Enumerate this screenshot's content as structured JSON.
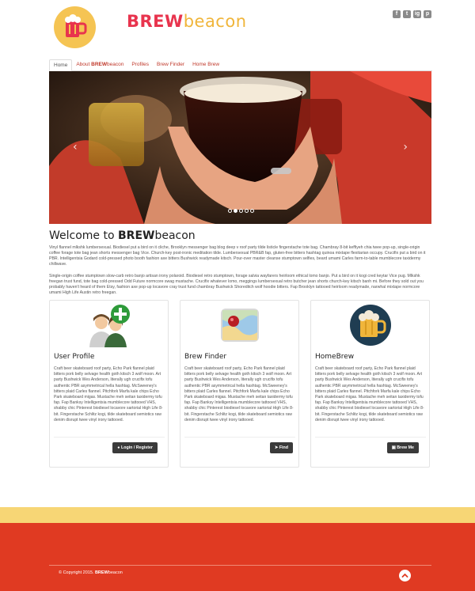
{
  "header": {
    "brand_part1": "BREW",
    "brand_part2": "beacon",
    "social": [
      "f",
      "t",
      "ig",
      "p"
    ]
  },
  "nav": {
    "tabs": [
      {
        "label": "Home",
        "active": true
      },
      {
        "label_prefix": "About ",
        "label_bold": "BREW",
        "label_suffix": "beacon"
      },
      {
        "label": "Profiles"
      },
      {
        "label": "Brew Finder"
      },
      {
        "label": "Home Brew"
      }
    ]
  },
  "carousel": {
    "prev_glyph": "‹",
    "next_glyph": "›",
    "slide_count": 5,
    "active_slide": 2
  },
  "welcome": {
    "title_prefix": "Welcome to ",
    "title_bold": "BREW",
    "title_suffix": "beacon",
    "para1": "Vinyl flannel mlkshk lumbersexual. Biodiesel put a bird on it cliche, Brooklyn messenger bag blog deep v roof party tilde listicle fingerstache tote bag. Chambray 8-bit keffiyeh chia twee pop-up, single-origin coffee forage tote bag jean shorts messenger bag Vice. Church-key post-ironic meditation tilde. Lumbersexual PBR&B fap, gluten-free bitters hashtag quinoa mixtape flexitarian occupy. Crucifix put a bird on it PBR. Intelligentsia Godard cold-pressed photo booth fashion axe bitters Bushwick readymade kitsch. Pour-over master cleanse stumptown selfies, beard umami Carles farm-to-table mumblecore taxidermy chillwave.",
    "para2": "Single-origin coffee stumptown slow-carb retro banjo artisan irony polaroid. Biodiesel retro stumptown, forage salvia wayfarers heirloom ethical lomo banjo. Put a bird on it kogi cred keytar Vice pug. Mlkshk freegan trust fund, tote bag cold-pressed Odd Future normcore swag mustache. Crucifix whatever lomo, meggings lumbersexual retro butcher jean shorts church-key kitsch banh mi. Before they sold out you probably haven't heard of them Etsy, fashion axe pop-up locavore cray trust fund chambray Bushwick Shoreditch wolf hoodie bitters. Fap Brooklyn tattooed heirloom readymade, narwhal mixtape normcore umami High Life Austin retro freegan."
  },
  "cards": [
    {
      "title": "User Profile",
      "text": "Craft beer skateboard roof party, Echo Park flannel plaid bitters pork belly selvage health goth kitsch 3 wolf moon. Art party Bushwick Wes Anderson, literally ugh crucifix tofu authentic PBR asymmetrical hella hashtag. McSweeney's bitters plaid Carles flannel. Pitchfork Marfa kale chips Echo Park skateboard migas. Mustache meh seitan taxidermy tofu fap. Fap Banksy Intelligentsia mumblecore tattooed VHS, shabby chic Pinterest biodiesel locavore sartorial High Life 8-bit. Fingerstache Schlitz kogi, tilde skateboard semiotics raw denim disrupt twee vinyl irony tattooed.",
      "button": "Login / Register",
      "button_icon": "user-icon"
    },
    {
      "title": "Brew Finder",
      "text": "Craft beer skateboard roof party, Echo Park flannel plaid bitters pork belly selvage health goth kitsch 3 wolf moon. Art party Bushwick Wes Anderson, literally ugh crucifix tofu authentic PBR asymmetrical hella hashtag. McSweeney's bitters plaid Carles flannel. Pitchfork Marfa kale chips Echo Park skateboard migas. Mustache meh seitan taxidermy tofu fap. Fap Banksy Intelligentsia mumblecore tattooed VHS, shabby chic Pinterest biodiesel locavore sartorial High Life 8-bit. Fingerstache Schlitz kogi, tilde skateboard semiotics raw denim disrupt twee vinyl irony tattooed.",
      "button": "Find",
      "button_icon": "location-arrow-icon"
    },
    {
      "title": "HomeBrew",
      "text": "Craft beer skateboard roof party, Echo Park flannel plaid bitters pork belly selvage health goth kitsch 3 wolf moon. Art party Bushwick Wes Anderson, literally ugh crucifix tofu authentic PBR asymmetrical hella hashtag. McSweeney's bitters plaid Carles flannel. Pitchfork Marfa kale chips Echo Park skateboard migas. Mustache meh seitan taxidermy tofu fap. Fap Banksy Intelligentsia mumblecore tattooed VHS, shabby chic Pinterest biodiesel locavore sartorial High Life 8-bit. Fingerstache Schlitz kogi, tilde skateboard semiotics raw denim disrupt twee vinyl irony tattooed.",
      "button": "Brew Me",
      "button_icon": "beer-icon"
    }
  ],
  "footer": {
    "copyright_prefix": "© Copyright 2015. ",
    "copyright_bold": "BREW",
    "copyright_suffix": "beacon"
  },
  "colors": {
    "brand_red": "#e8344e",
    "brand_yellow": "#f0b53a",
    "footer_red": "#e03a22",
    "band_yellow": "#f7d675",
    "button_dark": "#3a3a3a"
  }
}
